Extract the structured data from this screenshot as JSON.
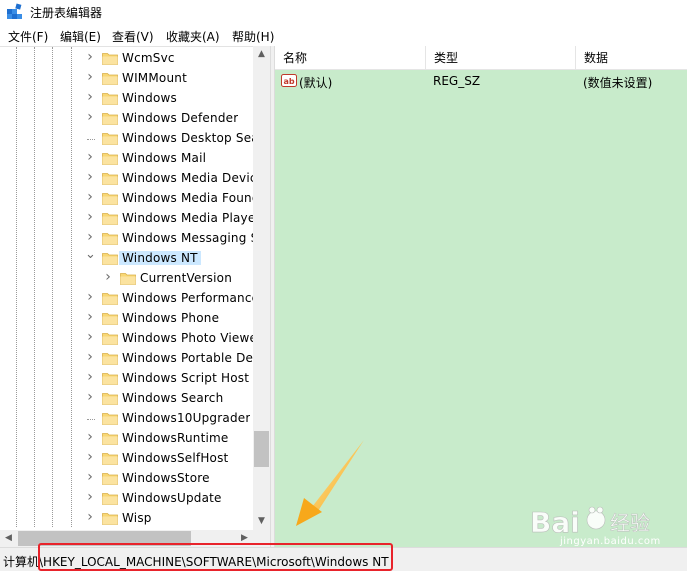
{
  "window": {
    "title": "注册表编辑器"
  },
  "menu": [
    {
      "label": "文件(F)"
    },
    {
      "label": "编辑(E)"
    },
    {
      "label": "查看(V)"
    },
    {
      "label": "收藏夹(A)"
    },
    {
      "label": "帮助(H)"
    }
  ],
  "tree": {
    "items": [
      {
        "label": "WcmSvc",
        "expander": true
      },
      {
        "label": "WIMMount",
        "expander": true
      },
      {
        "label": "Windows",
        "expander": true
      },
      {
        "label": "Windows Defender",
        "expander": true
      },
      {
        "label": "Windows Desktop Sea",
        "expander": false
      },
      {
        "label": "Windows Mail",
        "expander": true
      },
      {
        "label": "Windows Media Devic",
        "expander": true
      },
      {
        "label": "Windows Media Found",
        "expander": true
      },
      {
        "label": "Windows Media Player",
        "expander": true
      },
      {
        "label": "Windows Messaging S",
        "expander": true
      },
      {
        "label": "Windows NT",
        "expander": true,
        "expanded": true,
        "selected": true
      },
      {
        "label": "CurrentVersion",
        "expander": true,
        "child": true
      },
      {
        "label": "Windows Performance",
        "expander": true
      },
      {
        "label": "Windows Phone",
        "expander": true
      },
      {
        "label": "Windows Photo Viewe",
        "expander": true
      },
      {
        "label": "Windows Portable Dev",
        "expander": true
      },
      {
        "label": "Windows Script Host",
        "expander": true
      },
      {
        "label": "Windows Search",
        "expander": true
      },
      {
        "label": "Windows10Upgrader",
        "expander": false
      },
      {
        "label": "WindowsRuntime",
        "expander": true
      },
      {
        "label": "WindowsSelfHost",
        "expander": true
      },
      {
        "label": "WindowsStore",
        "expander": true
      },
      {
        "label": "WindowsUpdate",
        "expander": true
      },
      {
        "label": "Wisp",
        "expander": true
      }
    ]
  },
  "list": {
    "columns": [
      "名称",
      "类型",
      "数据"
    ],
    "rows": [
      {
        "icon": "ab-string-value-icon",
        "name": "(默认)",
        "type": "REG_SZ",
        "data": "(数值未设置)"
      }
    ]
  },
  "status": {
    "path": "计算机\\HKEY_LOCAL_MACHINE\\SOFTWARE\\Microsoft\\Windows NT"
  },
  "colors": {
    "list_background": "#c8ebcb",
    "selection": "#cce8ff",
    "folder": "#f8d775",
    "highlight_box": "#e8232b",
    "arrow": "#f7b21b"
  },
  "watermark": {
    "brand": "Bai 经验",
    "url": "jingyan.baidu.com"
  }
}
